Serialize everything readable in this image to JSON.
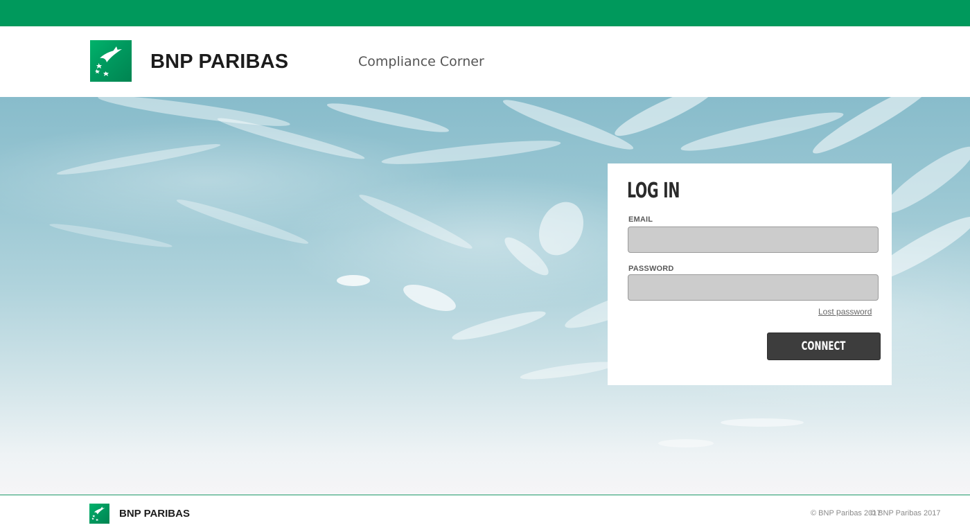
{
  "colors": {
    "brand_green": "#00995c",
    "footer_line": "#1f9a6a",
    "button_dark": "#3d3d3d",
    "input_fill": "#cccccc"
  },
  "header": {
    "logo_icon": "bnp-stars-birds-logo-icon",
    "brand_name": "BNP PARIBAS",
    "app_title": "Compliance Corner"
  },
  "hero": {
    "background": "cloudy-sky-image"
  },
  "login": {
    "title": "LOG IN",
    "email_label": "EMAIL",
    "email_value": "",
    "password_label": "PASSWORD",
    "password_value": "",
    "lost_password": "Lost password",
    "connect_label": "CONNECT"
  },
  "footer": {
    "logo_icon": "bnp-stars-birds-logo-icon",
    "brand_name": "BNP PARIBAS",
    "copyright_a": "© BNP Paribas 2017",
    "copyright_b": "© BNP Paribas 2017"
  }
}
